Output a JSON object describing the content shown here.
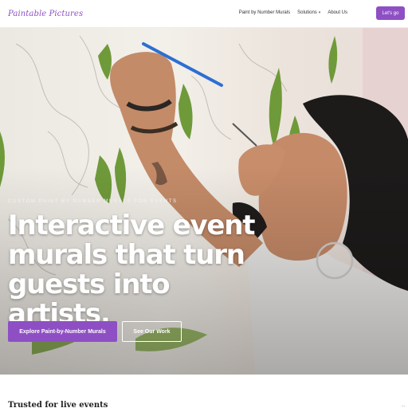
{
  "brand": {
    "logo_text": "Paintable Pictures",
    "accent": "#8e4fc4"
  },
  "nav": {
    "items": [
      "Paint by Number Murals",
      "Solutions",
      "About Us"
    ],
    "cta_label": "Let's go"
  },
  "hero": {
    "eyebrow": "Custom paint by number murals for events",
    "headline": "Interactive event murals that turn guests into artists.",
    "primary_button": "Explore Paint-by-Number Murals",
    "secondary_button": "See Our Work"
  },
  "below": {
    "section_title": "Trusted for live events",
    "right_note": "..."
  },
  "icons": {
    "solutions_dropdown": "chevron-down-icon"
  }
}
